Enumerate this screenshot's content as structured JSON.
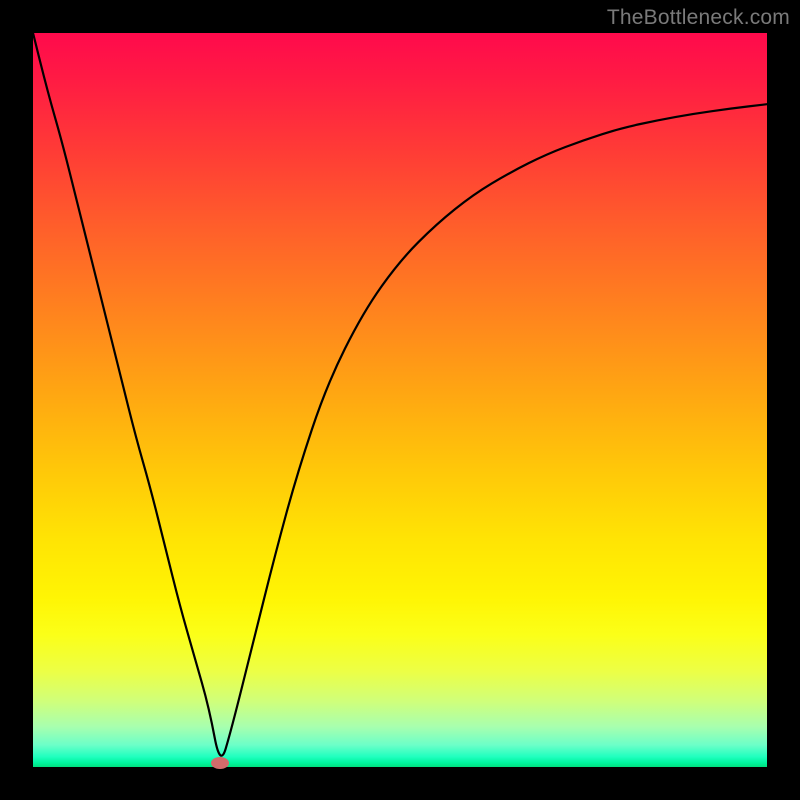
{
  "watermark": "TheBottleneck.com",
  "chart_data": {
    "type": "line",
    "title": "",
    "xlabel": "",
    "ylabel": "",
    "xlim": [
      0,
      100
    ],
    "ylim": [
      0,
      100
    ],
    "grid": false,
    "legend": false,
    "series": [
      {
        "name": "bottleneck-curve",
        "x": [
          0,
          2,
          4,
          6,
          8,
          10,
          12,
          14,
          16,
          18,
          20,
          22,
          24,
          25.5,
          27,
          30,
          33,
          36,
          40,
          45,
          50,
          55,
          60,
          65,
          70,
          75,
          80,
          85,
          90,
          95,
          100
        ],
        "y": [
          100,
          92,
          85,
          77,
          69,
          61,
          53,
          45,
          38,
          30,
          22,
          15,
          8,
          0,
          5,
          17,
          29,
          40,
          52,
          62,
          69,
          74,
          78,
          81,
          83.5,
          85.4,
          87,
          88.1,
          89,
          89.7,
          90.3
        ]
      }
    ],
    "annotations": [
      {
        "name": "minimum-point",
        "x": 25.5,
        "y": 0
      }
    ],
    "background_gradient": {
      "top": "#ff0a4c",
      "upper_mid": "#ff801f",
      "mid": "#ffe404",
      "lower_mid": "#ecff46",
      "bottom": "#00e07f"
    }
  }
}
